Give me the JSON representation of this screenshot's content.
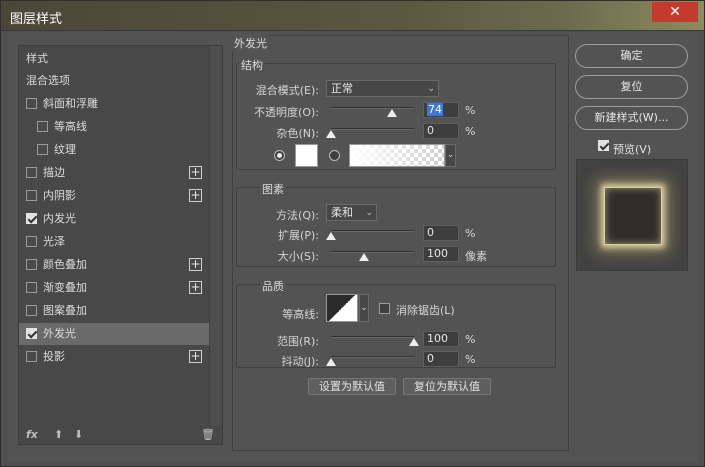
{
  "window": {
    "title": "图层样式",
    "close_glyph": "✕"
  },
  "left_panel": {
    "header": "样式",
    "items": [
      {
        "label": "混合选项",
        "checkbox": false,
        "checked": false,
        "plus": false,
        "indent": false
      },
      {
        "label": "斜面和浮雕",
        "checkbox": true,
        "checked": false,
        "plus": false,
        "indent": false
      },
      {
        "label": "等高线",
        "checkbox": true,
        "checked": false,
        "plus": false,
        "indent": true
      },
      {
        "label": "纹理",
        "checkbox": true,
        "checked": false,
        "plus": false,
        "indent": true
      },
      {
        "label": "描边",
        "checkbox": true,
        "checked": false,
        "plus": true,
        "indent": false
      },
      {
        "label": "内阴影",
        "checkbox": true,
        "checked": false,
        "plus": true,
        "indent": false
      },
      {
        "label": "内发光",
        "checkbox": true,
        "checked": true,
        "plus": false,
        "indent": false
      },
      {
        "label": "光泽",
        "checkbox": true,
        "checked": false,
        "plus": false,
        "indent": false
      },
      {
        "label": "颜色叠加",
        "checkbox": true,
        "checked": false,
        "plus": true,
        "indent": false
      },
      {
        "label": "渐变叠加",
        "checkbox": true,
        "checked": false,
        "plus": true,
        "indent": false
      },
      {
        "label": "图案叠加",
        "checkbox": true,
        "checked": false,
        "plus": false,
        "indent": false
      },
      {
        "label": "外发光",
        "checkbox": true,
        "checked": true,
        "plus": false,
        "indent": false,
        "selected": true
      },
      {
        "label": "投影",
        "checkbox": true,
        "checked": false,
        "plus": true,
        "indent": false
      }
    ],
    "plus_glyph": "+",
    "footer": {
      "fx": "fx",
      "fx_sub": ".",
      "up": "⬆",
      "down": "⬇",
      "trash": "🗑"
    }
  },
  "outer_glow": {
    "title": "外发光",
    "structure": {
      "title": "结构",
      "blend_mode_label": "混合模式(E):",
      "blend_mode_value": "正常",
      "opacity_label": "不透明度(O):",
      "opacity_value": "74",
      "noise_label": "杂色(N):",
      "noise_value": "0",
      "unit_percent": "%"
    },
    "elements": {
      "title": "图素",
      "technique_label": "方法(Q):",
      "technique_value": "柔和",
      "spread_label": "扩展(P):",
      "spread_value": "0",
      "size_label": "大小(S):",
      "size_value": "100",
      "size_unit": "像素"
    },
    "quality": {
      "title": "品质",
      "contour_label": "等高线:",
      "anti_alias_label": "消除锯齿(L)",
      "range_label": "范围(R):",
      "range_value": "100",
      "jitter_label": "抖动(J):",
      "jitter_value": "0"
    },
    "buttons": {
      "set_default": "设置为默认值",
      "reset_default": "复位为默认值"
    },
    "levels": {
      "opacity": 0.74,
      "noise": 0,
      "spread": 0,
      "size": 0.4,
      "range": 1.0,
      "jitter": 0
    }
  },
  "right": {
    "ok": "确定",
    "reset": "复位",
    "new_style": "新建样式(W)...",
    "preview_label": "预览(V)"
  },
  "arrow_glyph": "⌄"
}
